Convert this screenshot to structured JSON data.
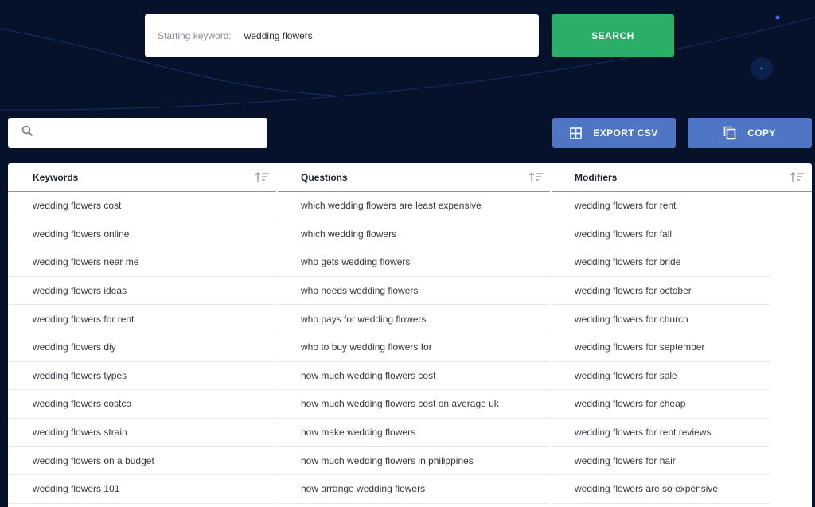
{
  "search": {
    "label": "Starting keyword:",
    "value": "wedding flowers",
    "button_label": "SEARCH"
  },
  "filter": {
    "placeholder": ""
  },
  "actions": {
    "export_label": "EXPORT CSV",
    "copy_label": "COPY"
  },
  "table": {
    "headers": {
      "keywords": "Keywords",
      "questions": "Questions",
      "modifiers": "Modifiers"
    },
    "rows": [
      {
        "keyword": "wedding flowers cost",
        "question": "which wedding flowers are least expensive",
        "modifier": "wedding flowers for rent"
      },
      {
        "keyword": "wedding flowers online",
        "question": "which wedding flowers",
        "modifier": "wedding flowers for fall"
      },
      {
        "keyword": "wedding flowers near me",
        "question": "who gets wedding flowers",
        "modifier": "wedding flowers for bride"
      },
      {
        "keyword": "wedding flowers ideas",
        "question": "who needs wedding flowers",
        "modifier": "wedding flowers for october"
      },
      {
        "keyword": "wedding flowers for rent",
        "question": "who pays for wedding flowers",
        "modifier": "wedding flowers for church"
      },
      {
        "keyword": "wedding flowers diy",
        "question": "who to buy wedding flowers for",
        "modifier": "wedding flowers for september"
      },
      {
        "keyword": "wedding flowers types",
        "question": "how much wedding flowers cost",
        "modifier": "wedding flowers for sale"
      },
      {
        "keyword": "wedding flowers costco",
        "question": "how much wedding flowers cost on average uk",
        "modifier": "wedding flowers for cheap"
      },
      {
        "keyword": "wedding flowers strain",
        "question": "how make wedding flowers",
        "modifier": "wedding flowers for rent reviews"
      },
      {
        "keyword": "wedding flowers on a budget",
        "question": "how much wedding flowers in philippines",
        "modifier": "wedding flowers for hair"
      },
      {
        "keyword": "wedding flowers 101",
        "question": "how arrange wedding flowers",
        "modifier": "wedding flowers are so expensive"
      }
    ]
  },
  "colors": {
    "background": "#06112b",
    "search_button": "#2aae68",
    "action_button": "#4e76c4"
  },
  "icons": [
    "search-icon",
    "grid-icon",
    "copy-icon",
    "sort-icon"
  ]
}
